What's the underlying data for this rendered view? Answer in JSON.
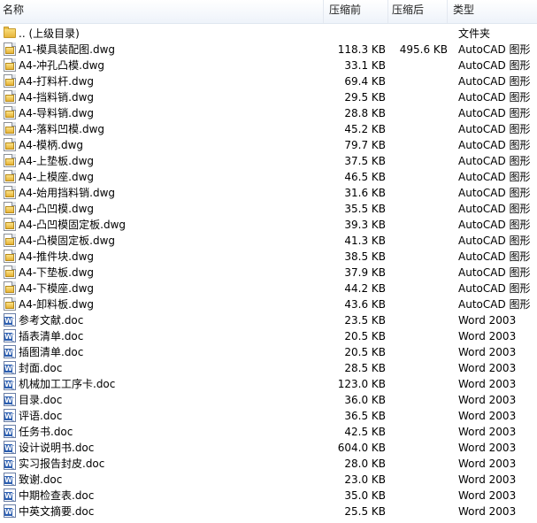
{
  "columns": {
    "name": "名称",
    "size": "压缩前",
    "compressed": "压缩后",
    "type": "类型"
  },
  "files": [
    {
      "icon": "folder-icon",
      "name": ".. (上级目录)",
      "size": "",
      "compressed": "",
      "type": "文件夹"
    },
    {
      "icon": "dwg-file-icon",
      "name": "A1-模具装配图.dwg",
      "size": "118.3 KB",
      "compressed": "495.6 KB",
      "type": "AutoCAD 图形"
    },
    {
      "icon": "dwg-file-icon",
      "name": "A4-冲孔凸模.dwg",
      "size": "33.1 KB",
      "compressed": "",
      "type": "AutoCAD 图形"
    },
    {
      "icon": "dwg-file-icon",
      "name": "A4-打料杆.dwg",
      "size": "69.4 KB",
      "compressed": "",
      "type": "AutoCAD 图形"
    },
    {
      "icon": "dwg-file-icon",
      "name": "A4-挡料销.dwg",
      "size": "29.5 KB",
      "compressed": "",
      "type": "AutoCAD 图形"
    },
    {
      "icon": "dwg-file-icon",
      "name": "A4-导料销.dwg",
      "size": "28.8 KB",
      "compressed": "",
      "type": "AutoCAD 图形"
    },
    {
      "icon": "dwg-file-icon",
      "name": "A4-落料凹模.dwg",
      "size": "45.2 KB",
      "compressed": "",
      "type": "AutoCAD 图形"
    },
    {
      "icon": "dwg-file-icon",
      "name": "A4-模柄.dwg",
      "size": "79.7 KB",
      "compressed": "",
      "type": "AutoCAD 图形"
    },
    {
      "icon": "dwg-file-icon",
      "name": "A4-上垫板.dwg",
      "size": "37.5 KB",
      "compressed": "",
      "type": "AutoCAD 图形"
    },
    {
      "icon": "dwg-file-icon",
      "name": "A4-上模座.dwg",
      "size": "46.5 KB",
      "compressed": "",
      "type": "AutoCAD 图形"
    },
    {
      "icon": "dwg-file-icon",
      "name": "A4-始用挡料销.dwg",
      "size": "31.6 KB",
      "compressed": "",
      "type": "AutoCAD 图形"
    },
    {
      "icon": "dwg-file-icon",
      "name": "A4-凸凹模.dwg",
      "size": "35.5 KB",
      "compressed": "",
      "type": "AutoCAD 图形"
    },
    {
      "icon": "dwg-file-icon",
      "name": "A4-凸凹模固定板.dwg",
      "size": "39.3 KB",
      "compressed": "",
      "type": "AutoCAD 图形"
    },
    {
      "icon": "dwg-file-icon",
      "name": "A4-凸模固定板.dwg",
      "size": "41.3 KB",
      "compressed": "",
      "type": "AutoCAD 图形"
    },
    {
      "icon": "dwg-file-icon",
      "name": "A4-推件块.dwg",
      "size": "38.5 KB",
      "compressed": "",
      "type": "AutoCAD 图形"
    },
    {
      "icon": "dwg-file-icon",
      "name": "A4-下垫板.dwg",
      "size": "37.9 KB",
      "compressed": "",
      "type": "AutoCAD 图形"
    },
    {
      "icon": "dwg-file-icon",
      "name": "A4-下模座.dwg",
      "size": "44.2 KB",
      "compressed": "",
      "type": "AutoCAD 图形"
    },
    {
      "icon": "dwg-file-icon",
      "name": "A4-卸料板.dwg",
      "size": "43.6 KB",
      "compressed": "",
      "type": "AutoCAD 图形"
    },
    {
      "icon": "doc-file-icon",
      "name": "参考文献.doc",
      "size": "23.5 KB",
      "compressed": "",
      "type": "Word 2003"
    },
    {
      "icon": "doc-file-icon",
      "name": "插表清单.doc",
      "size": "20.5 KB",
      "compressed": "",
      "type": "Word 2003"
    },
    {
      "icon": "doc-file-icon",
      "name": "插图清单.doc",
      "size": "20.5 KB",
      "compressed": "",
      "type": "Word 2003"
    },
    {
      "icon": "doc-file-icon",
      "name": "封面.doc",
      "size": "28.5 KB",
      "compressed": "",
      "type": "Word 2003"
    },
    {
      "icon": "doc-file-icon",
      "name": "机械加工工序卡.doc",
      "size": "123.0 KB",
      "compressed": "",
      "type": "Word 2003"
    },
    {
      "icon": "doc-file-icon",
      "name": "目录.doc",
      "size": "36.0 KB",
      "compressed": "",
      "type": "Word 2003"
    },
    {
      "icon": "doc-file-icon",
      "name": "评语.doc",
      "size": "36.5 KB",
      "compressed": "",
      "type": "Word 2003"
    },
    {
      "icon": "doc-file-icon",
      "name": "任务书.doc",
      "size": "42.5 KB",
      "compressed": "",
      "type": "Word 2003"
    },
    {
      "icon": "doc-file-icon",
      "name": "设计说明书.doc",
      "size": "604.0 KB",
      "compressed": "",
      "type": "Word 2003"
    },
    {
      "icon": "doc-file-icon",
      "name": "实习报告封皮.doc",
      "size": "28.0 KB",
      "compressed": "",
      "type": "Word 2003"
    },
    {
      "icon": "doc-file-icon",
      "name": "致谢.doc",
      "size": "23.0 KB",
      "compressed": "",
      "type": "Word 2003"
    },
    {
      "icon": "doc-file-icon",
      "name": "中期检查表.doc",
      "size": "35.0 KB",
      "compressed": "",
      "type": "Word 2003"
    },
    {
      "icon": "doc-file-icon",
      "name": "中英文摘要.doc",
      "size": "25.5 KB",
      "compressed": "",
      "type": "Word 2003"
    }
  ]
}
